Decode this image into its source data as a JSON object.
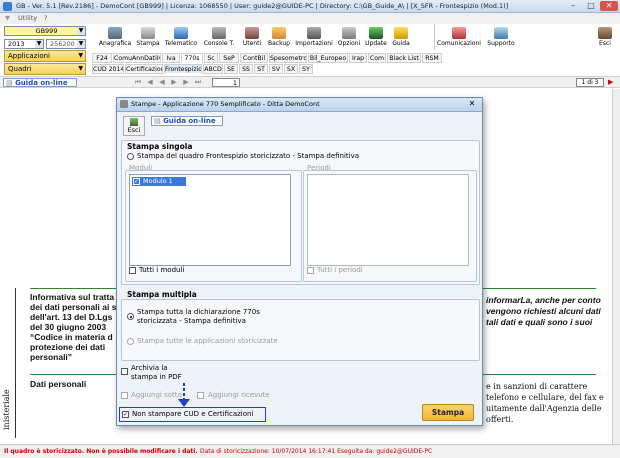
{
  "window": {
    "title": "GB - Ver. 5.1 [Rev.2186] - DemoCont [GB999]   | Licenza: 1068550 | User: guide2@GUIDE-PC | Directory: C:\\GB_Guide_A\\ |   [X_SFR - Frontespizio (Mod.1)]",
    "menu_utility": "Utility",
    "menu_help": "?"
  },
  "selectors": {
    "company": "GB999",
    "year": "2013",
    "code": "256200",
    "applicazioni": "Applicazioni",
    "quadri": "Quadri"
  },
  "toolbar": [
    {
      "label": "Anagrafica",
      "icon": "anagrafica-icon"
    },
    {
      "label": "Stampa",
      "icon": "printer-icon"
    },
    {
      "label": "Telematico",
      "icon": "telematico-icon"
    },
    {
      "label": "Console T.",
      "icon": "console-icon"
    },
    {
      "label": "Utenti",
      "icon": "users-icon"
    },
    {
      "label": "Backup",
      "icon": "backup-icon"
    },
    {
      "label": "Importazioni",
      "icon": "import-icon"
    },
    {
      "label": "Opzioni",
      "icon": "options-icon"
    },
    {
      "label": "Update",
      "icon": "update-icon"
    },
    {
      "label": "Guida",
      "icon": "help-icon"
    },
    {
      "label": "Comunicazioni",
      "icon": "communications-icon"
    },
    {
      "label": "Supporto",
      "icon": "support-icon"
    },
    {
      "label": "Esci",
      "icon": "exit-door-icon"
    }
  ],
  "tabs_row1": [
    "F24",
    "ComuAnnDatiIva",
    "Iva",
    "770s",
    "Sc",
    "SeP",
    "ContBil",
    "Spesometro",
    "Bil_Europeo",
    "Irap",
    "Com",
    "Black List",
    "RSM"
  ],
  "tabs_row2": [
    "CUD 2014",
    "Certificazioni",
    "Frontespizio",
    "ABCD",
    "SE",
    "SS",
    "ST",
    "SV",
    "SX",
    "SY"
  ],
  "tabs_row2_active": "Frontespizio",
  "guida": {
    "label": "Guida on-line",
    "page_value": "1",
    "page_count": "1 di 3"
  },
  "doc": {
    "left_lines": [
      "Informativa sul tratta",
      "dei dati personali ai s",
      "dell'art. 13 del D.Lgs",
      "del 30 giugno 2003",
      "“Codice in materia d",
      "protezione dei dati",
      "personali”"
    ],
    "right_lines": [
      "informarLa, anche per conto",
      "vengono richiesti alcuni dati",
      "tali dati e quali sono i suoi"
    ],
    "dati_personali": "Dati personali",
    "side_label": "inisteriale",
    "right_bottom_lines": [
      "e in sanzioni di carattere",
      "telefono e cellulare, del fax e",
      "uitamente dall'Agenzia delle",
      "offerti."
    ]
  },
  "dialog": {
    "title": "Stampe - Applicazione 770 Semplificato - Ditta  DemoCont",
    "esci": "Esci",
    "guida": "Guida on-line",
    "stampa_singola": "Stampa singola",
    "radio_singola": "Stampa del quadro Frontespizio storicizzato - Stampa definitiva",
    "moduli": "Moduli",
    "modulo_item": "Modulo 1",
    "periodi": "Periodi",
    "tutti_moduli": "Tutti i moduli",
    "tutti_periodi": "Tutti i periodi",
    "stampa_multipla": "Stampa multipla",
    "radio_multi1_a": "Stampa tutta la dichiarazione 770s",
    "radio_multi1_b": "storicizzata - Stampa definitiva",
    "radio_multi2": "Stampa tutte le applicazioni storicizzate",
    "archivia_a": "Archivia la",
    "archivia_b": "stampa in PDF",
    "aggiungi_sottoquadri": "Aggiungi sotto",
    "aggiungi_ricevute": "Aggiungi ricevute",
    "non_stampare": "Non stampare CUD e Certificazioni",
    "stampa_button": "Stampa"
  },
  "status": {
    "text_red": "Il quadro è storicizzato. Non è possibile modificare i dati.",
    "text_info": "Data di storicizzazione: 10/07/2014 16:17:41 Eseguita da: guide2@GUIDE-PC"
  },
  "colors": {
    "accent": "#1f4fb5",
    "status_red": "#cc0000",
    "highlight_box": "#1e3fd0",
    "stampa_button": "#f3c24a"
  }
}
